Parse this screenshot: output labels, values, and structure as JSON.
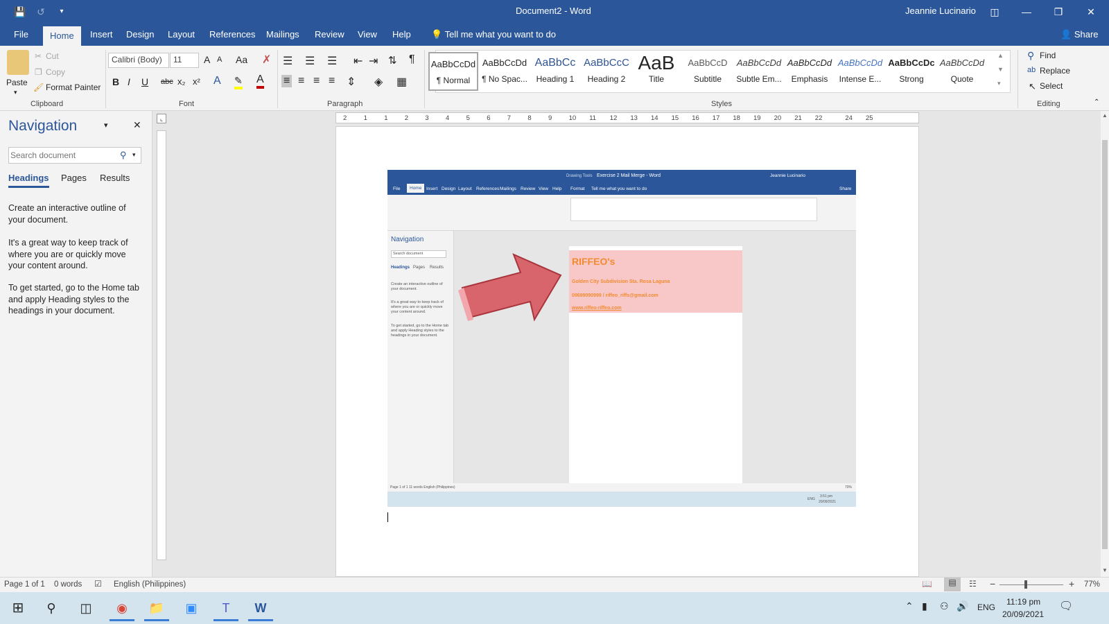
{
  "window": {
    "title": "Document2 - Word",
    "user": "Jeannie Lucinario"
  },
  "menu": {
    "tabs": [
      "File",
      "Home",
      "Insert",
      "Design",
      "Layout",
      "References",
      "Mailings",
      "Review",
      "View",
      "Help"
    ],
    "tell_me": "Tell me what you want to do",
    "share": "Share"
  },
  "clipboard": {
    "paste": "Paste",
    "cut": "Cut",
    "copy": "Copy",
    "format_painter": "Format Painter",
    "label": "Clipboard"
  },
  "font": {
    "name": "Calibri (Body)",
    "size": "11",
    "label": "Font",
    "grow": "A",
    "case": "Aa",
    "bold": "B",
    "italic": "I",
    "underline": "U",
    "strike": "abc",
    "sub": "x₂",
    "sup": "x²"
  },
  "paragraph": {
    "label": "Paragraph"
  },
  "styles": {
    "label": "Styles",
    "items": [
      {
        "preview": "AaBbCcDd",
        "name": "¶ Normal"
      },
      {
        "preview": "AaBbCcDd",
        "name": "¶ No Spac..."
      },
      {
        "preview": "AaBbCc",
        "name": "Heading 1"
      },
      {
        "preview": "AaBbCcC",
        "name": "Heading 2"
      },
      {
        "preview": "AaB",
        "name": "Title"
      },
      {
        "preview": "AaBbCcD",
        "name": "Subtitle"
      },
      {
        "preview": "AaBbCcDd",
        "name": "Subtle Em..."
      },
      {
        "preview": "AaBbCcDd",
        "name": "Emphasis"
      },
      {
        "preview": "AaBbCcDd",
        "name": "Intense E..."
      },
      {
        "preview": "AaBbCcDc",
        "name": "Strong"
      },
      {
        "preview": "AaBbCcDd",
        "name": "Quote"
      }
    ]
  },
  "editing": {
    "find": "Find",
    "replace": "Replace",
    "select": "Select",
    "label": "Editing"
  },
  "navigation": {
    "title": "Navigation",
    "search_placeholder": "Search document",
    "tabs": [
      "Headings",
      "Pages",
      "Results"
    ],
    "help1": "Create an interactive outline of your document.",
    "help2": "It's a great way to keep track of where you are or quickly move your content around.",
    "help3": "To get started, go to the Home tab and apply Heading styles to the headings in your document."
  },
  "ruler": {
    "ticks": [
      "2",
      "1",
      "1",
      "2",
      "3",
      "4",
      "5",
      "6",
      "7",
      "8",
      "9",
      "10",
      "11",
      "12",
      "13",
      "14",
      "15",
      "16",
      "17",
      "18",
      "19",
      "20",
      "21",
      "22",
      "24",
      "25"
    ]
  },
  "inner": {
    "window_title": "Exercise 2 Mail Merge - Word",
    "drawing_tools": "Drawing Tools",
    "user": "Jeannie Lucinario",
    "tabs": [
      "File",
      "Home",
      "Insert",
      "Design",
      "Layout",
      "References",
      "Mailings",
      "Review",
      "View",
      "Help",
      "Format"
    ],
    "tell_me": "Tell me what you want to do",
    "share": "Share",
    "nav_title": "Navigation",
    "nav_search": "Search document",
    "nav_tabs": [
      "Headings",
      "Pages",
      "Results"
    ],
    "nav_help1": "Create an interactive outline of your document.",
    "nav_help2": "It's a great way to keep track of where you are or quickly move your content around.",
    "nav_help3": "To get started, go to the Home tab and apply Heading styles to the headings in your document.",
    "card_name": "RIFFEO's",
    "card_address": "Golden City Subdivision Sta. Rosa Laguna",
    "card_contact": "09699090999 / riffeo_riffs@gmail.com",
    "card_web": "www.riffeo-riffeo.com",
    "status": "Page 1 of 1     11 words     English (Philippines)",
    "zoom": "70%",
    "time": "3:51 pm",
    "date": "20/09/2021",
    "lang": "ENG"
  },
  "status": {
    "page": "Page 1 of 1",
    "words": "0 words",
    "language": "English (Philippines)",
    "zoom": "77%"
  },
  "taskbar": {
    "lang": "ENG",
    "time": "11:19 pm",
    "date": "20/09/2021"
  }
}
